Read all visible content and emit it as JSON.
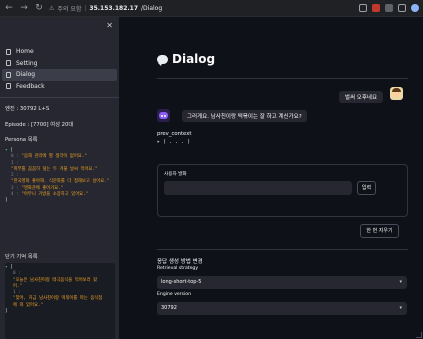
{
  "browser": {
    "back": "←",
    "forward": "→",
    "reload": "↻",
    "insecure_label": "주의 요함",
    "url_host": "35.153.182.17",
    "url_path": "/Dialog"
  },
  "sidebar": {
    "close": "✕",
    "nav": [
      {
        "label": "Home"
      },
      {
        "label": "Setting"
      },
      {
        "label": "Dialog"
      },
      {
        "label": "Feedback"
      }
    ],
    "identity": "엔진 : 30792 L+S",
    "episode": "Episode : [7700] 여성 20대",
    "persona_title": "Persona 목록",
    "persona": [
      "\"음해 관리에 별 생각이 없어요.\"",
      "\"피부를 꼼꼼히 덮는 두 겨울 날씨 먹어요.\"",
      "\"한국영화 좋아해. 식문화를 다 접해보고 싶어요.\"",
      "\"영화관에 좋아가요.\"",
      "\"아무니 가방을 소장하고 있어요.\""
    ],
    "memory_title": "단기 기억 목록",
    "memory": [
      "\"오늘은 남사친이랑 테극음식을 먹어보러 왔어.\"",
      "\"맞아, 지금 남사친이랑 떡볶이를 파는 음식점 에 와 있어요.\""
    ]
  },
  "main": {
    "title": "Dialog",
    "user_message": "벌써 오후네요",
    "bot_message": "그러게요. 남사친이랑 떡볶이는 잘 하고 계신가요?",
    "prev_context_label": "prev_context",
    "prev_context_value": "( . . . )",
    "input_label": "사용자 발화",
    "input_value": "",
    "submit_label": "입력",
    "clear_label": "한 번 지우기",
    "settings_title": "응답 생성 방법 변경",
    "retrieval_label": "Retrieval strategy",
    "retrieval_value": "long-short-top-5",
    "engine_label": "Engine version",
    "engine_value": "30792"
  },
  "colors": {
    "background": "#0e1117",
    "sidebar": "#262730",
    "string": "#f5a623",
    "caret": "#3dd56d"
  }
}
